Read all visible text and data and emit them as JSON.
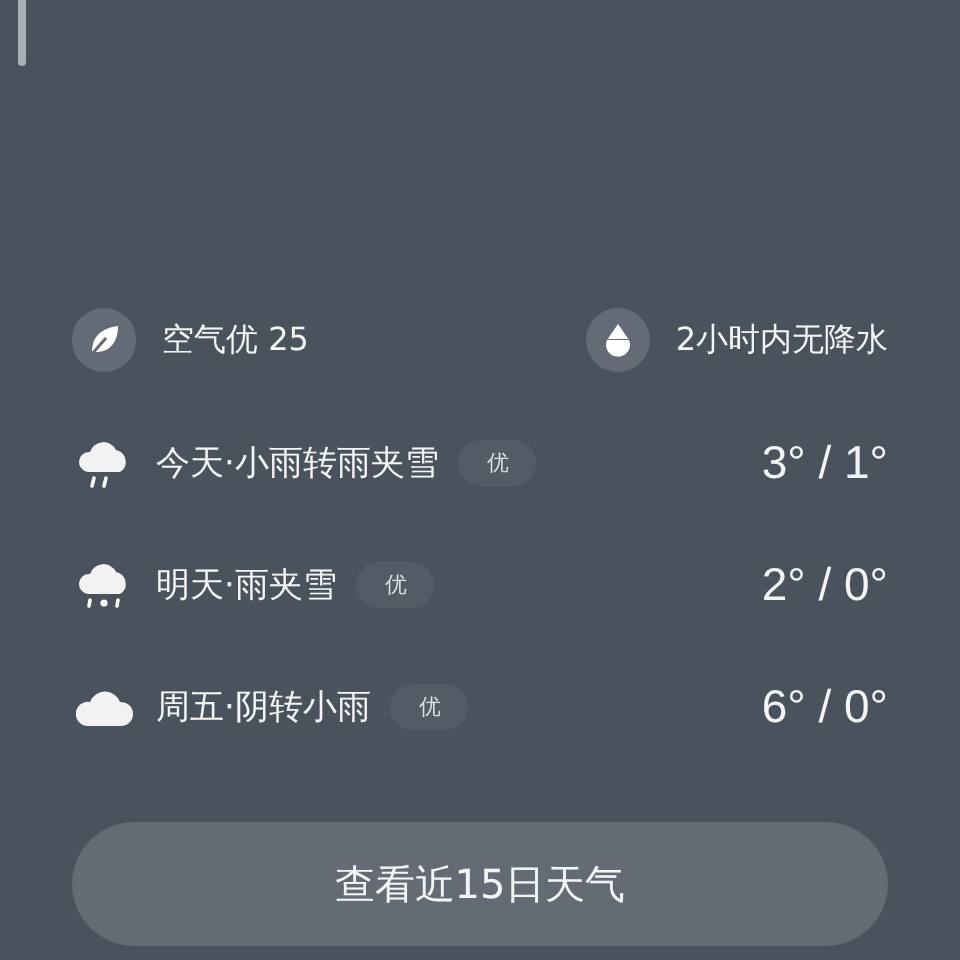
{
  "summary": [
    {
      "kind": "air",
      "text": "空气优 25"
    },
    {
      "kind": "rain",
      "text": "2小时内无降水"
    }
  ],
  "forecast": [
    {
      "kind": "rain",
      "label": "今天·小雨转雨夹雪",
      "badge": "优",
      "temps": "3° / 1°"
    },
    {
      "kind": "sleet",
      "label": "明天·雨夹雪",
      "badge": "优",
      "temps": "2° / 0°"
    },
    {
      "kind": "cloudy",
      "label": "周五·阴转小雨",
      "badge": "优",
      "temps": "6° / 0°"
    }
  ],
  "button": "查看近15日天气"
}
